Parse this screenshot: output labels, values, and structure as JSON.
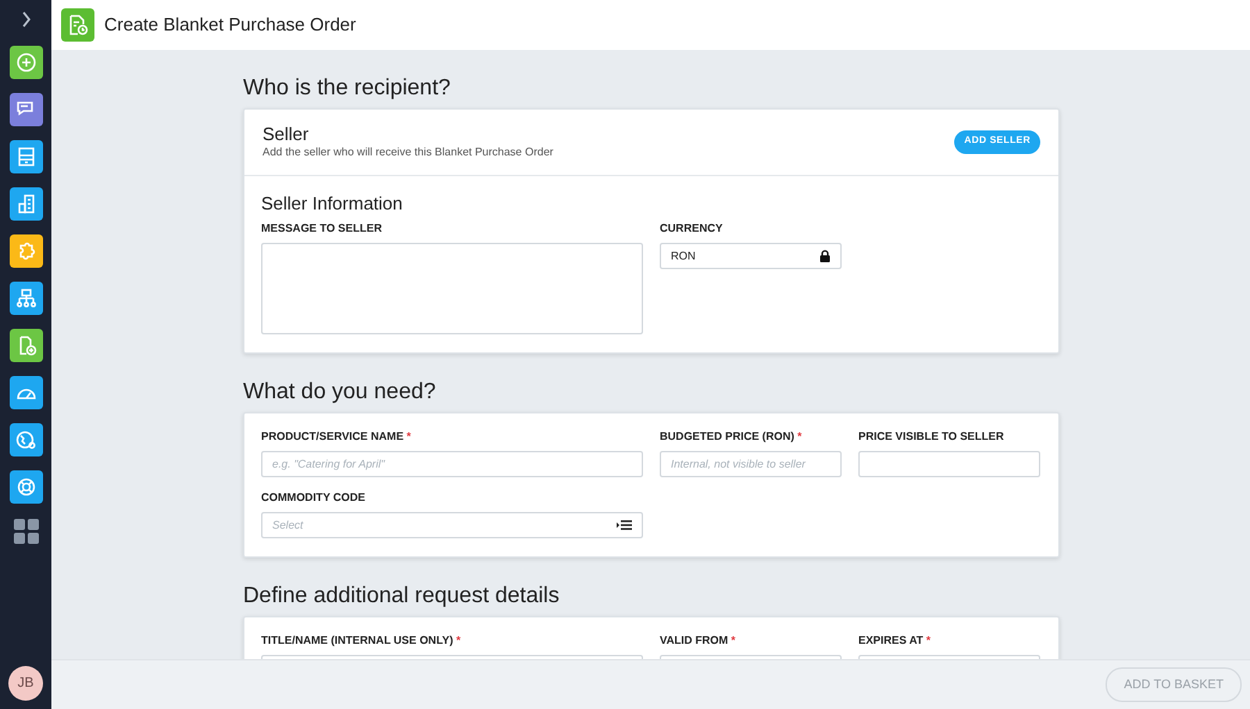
{
  "header": {
    "title": "Create Blanket Purchase Order"
  },
  "sidebar": {
    "items": [
      {
        "kind": "plus",
        "color": "#6cc644"
      },
      {
        "kind": "chat",
        "color": "#7b7fdc"
      },
      {
        "kind": "inbox",
        "color": "#1ea7f0"
      },
      {
        "kind": "building",
        "color": "#1ea7f0"
      },
      {
        "kind": "puzzle",
        "color": "#fbb917"
      },
      {
        "kind": "hierarchy",
        "color": "#1ea7f0"
      },
      {
        "kind": "document",
        "color": "#6cc644"
      },
      {
        "kind": "gauge",
        "color": "#1ea7f0"
      },
      {
        "kind": "globe",
        "color": "#1ea7f0"
      },
      {
        "kind": "lifebuoy",
        "color": "#1ea7f0"
      }
    ],
    "avatar": "JB"
  },
  "sections": [
    {
      "heading": "Who is the recipient?",
      "seller": {
        "title": "Seller",
        "subtitle": "Add the seller who will receive this Blanket Purchase Order",
        "button": "ADD SELLER"
      },
      "subheading": "Seller Information",
      "fields": [
        {
          "kind": "textarea",
          "label": "MESSAGE TO SELLER"
        },
        {
          "kind": "locked",
          "label": "CURRENCY",
          "value": "RON"
        }
      ]
    },
    {
      "heading": "What do you need?",
      "fields": [
        {
          "kind": "text",
          "label": "PRODUCT/SERVICE NAME",
          "required_mark": "*",
          "placeholder": "e.g. \"Catering for April\""
        },
        {
          "kind": "text",
          "label": "BUDGETED PRICE (RON)",
          "required_mark": "*",
          "placeholder": "Internal, not visible to seller"
        },
        {
          "kind": "text",
          "label": "PRICE VISIBLE TO SELLER"
        },
        {
          "kind": "select",
          "label": "COMMODITY CODE",
          "placeholder": "Select"
        }
      ]
    },
    {
      "heading": "Define additional request details",
      "fields": [
        {
          "kind": "text",
          "label": "TITLE/NAME (INTERNAL USE ONLY)",
          "required_mark": "*"
        },
        {
          "kind": "text",
          "label": "VALID FROM",
          "required_mark": "*"
        },
        {
          "kind": "text",
          "label": "EXPIRES AT",
          "required_mark": "*"
        }
      ]
    }
  ],
  "footer": {
    "button": "ADD TO BASKET",
    "disabled": true
  }
}
